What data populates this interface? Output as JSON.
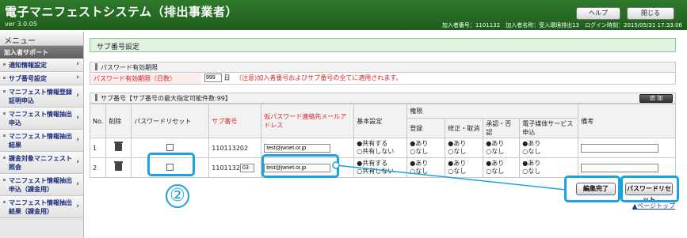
{
  "header": {
    "title": "電子マニフェストシステム（排出事業者）",
    "version": "ver 3.0.05",
    "help_label": "ヘルプ",
    "close_label": "閉じる",
    "user_info": "加入者番号：1101132　加入者名称：受入環境排出13　ログイン時刻：2015/05/31 17:33:06"
  },
  "sidebar": {
    "menu_label": "メニュー",
    "section_label": "加入者サポート",
    "items": [
      {
        "label": "通知情報設定"
      },
      {
        "label": "サブ番号設定"
      },
      {
        "label": "マニフェスト情報登録証明申込"
      },
      {
        "label": "マニフェスト情報抽出申込"
      },
      {
        "label": "マニフェスト情報抽出結果"
      },
      {
        "label": "課金対象マニフェスト照会"
      },
      {
        "label": "マニフェスト情報抽出申込（課金用）"
      },
      {
        "label": "マニフェスト情報抽出結果（課金用）"
      }
    ],
    "arrow": "›"
  },
  "main": {
    "page_title": "サブ番号設定",
    "pw_section_title": "パスワード有効期限",
    "pw_label": "パスワード有効期限（日数）",
    "pw_value": "999",
    "pw_unit": "日",
    "pw_note": "（注意)加入者番号およびサブ番号の全てに適用されます。",
    "sub_section_title": "サブ番号【サブ番号の最大指定可能件数:99】",
    "add_label": "追 加",
    "table": {
      "headers": {
        "no": "No.",
        "delete": "削除",
        "pw_reset": "パスワードリセット",
        "sub_no": "サブ番号",
        "email": "仮パスワード連絡先メールアドレス",
        "basic": "基本設定",
        "authority": "権限",
        "register": "登録",
        "modify": "修正・取消",
        "approve": "承認・否認",
        "e_media": "電子媒体サービス申込",
        "remarks": "備考"
      },
      "rows": [
        {
          "no": "1",
          "sub_no_prefix": "110113202",
          "sub_no_suffix": "",
          "email": "test@jwnet.or.jp",
          "basic_on": "●共有する",
          "basic_off": "○共有しない",
          "yes": "●あり",
          "no_opt": "○なし"
        },
        {
          "no": "2",
          "sub_no_prefix": "1101132",
          "sub_no_suffix": "03",
          "email": "test@jwnet.or.jp",
          "basic_on": "●共有する",
          "basic_off": "○共有しない",
          "yes": "●あり",
          "no_opt": "○なし"
        }
      ]
    }
  },
  "footer": {
    "edit_done_label": "編集完了",
    "pw_reset_label": "パスワードリセット",
    "page_top_label": "▲ページトップ"
  },
  "annotation": {
    "callout_number": "②",
    "highlight_color": "#1aa3e0"
  }
}
